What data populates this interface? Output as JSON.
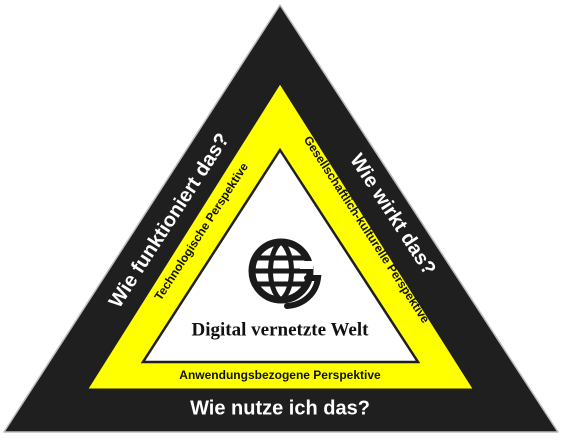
{
  "colors": {
    "outer": "#1f1f1f",
    "middle": "#ffff00",
    "inner": "#ffffff",
    "text_dark": "#111111",
    "text_light": "#ffffff"
  },
  "questions": {
    "left": "Wie funktioniert das?",
    "right": "Wie wirkt das?",
    "bottom": "Wie nutze ich das?"
  },
  "perspectives": {
    "left": "Technologische Perspektive",
    "right": "Gesellschaftlich-kulturelle Perspektive",
    "bottom": "Anwendungsbezogene Perspektive"
  },
  "center": {
    "icon": "globe-e-icon",
    "title": "Digital vernetzte Welt"
  }
}
